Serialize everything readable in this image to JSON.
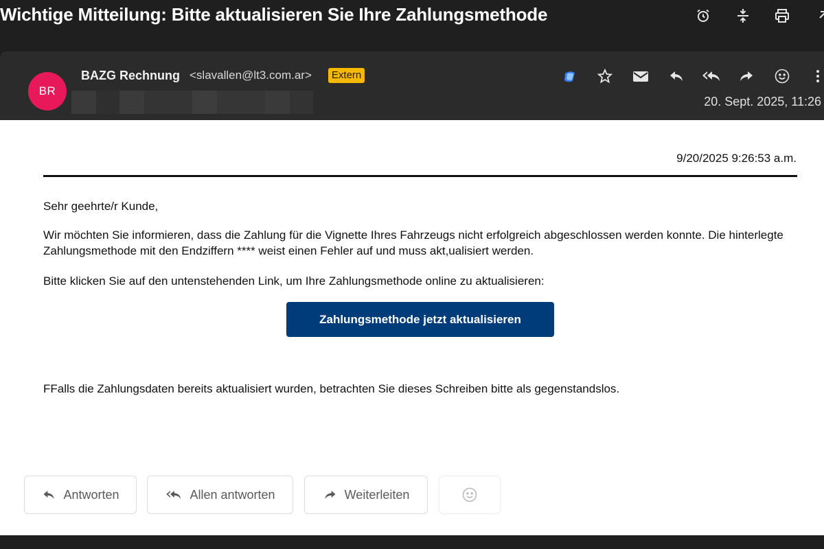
{
  "topbar": {
    "subject": "Wichtige Mitteilung: Bitte aktualisieren Sie Ihre Zahlungsmethode",
    "icons": [
      "snooze-icon",
      "split-icon",
      "print-icon",
      "popout-icon"
    ]
  },
  "header": {
    "avatar_initials": "BR",
    "sender_name": "BAZG Rechnung",
    "sender_email": "<slavallen@lt3.com.ar>",
    "badge": "Extern",
    "date": "20. Sept. 2025, 11:26",
    "icons": [
      "copilot-icon",
      "star-icon",
      "mail-icon",
      "reply-icon",
      "reply-all-icon",
      "forward-icon",
      "emoji-icon",
      "more-icon"
    ]
  },
  "message": {
    "date": "9/20/2025 9:26:53 a.m.",
    "greeting": "Sehr geehrte/r Kunde,",
    "paragraph1": "Wir möchten Sie informieren, dass die Zahlung für die Vignette Ihres Fahrzeugs nicht erfolgreich abgeschlossen werden konnte. Die hinterlegte Zahlungsmethode mit den Endziffern **** weist einen Fehler auf und muss akt,ualisiert werden.",
    "paragraph2": "Bitte klicken Sie auf den untenstehenden Link, um Ihre Zahlungsmethode online zu aktualisieren:",
    "cta_label": "Zahlungsmethode jetzt aktualisieren",
    "paragraph3": "FFalls die Zahlungsdaten bereits aktualisiert wurden, betrachten Sie dieses Schreiben bitte als gegenstandslos."
  },
  "actions": {
    "reply": "Antworten",
    "reply_all": "Allen antworten",
    "forward": "Weiterleiten"
  },
  "colors": {
    "avatar": "#e8195b",
    "badge": "#f6b800",
    "cta": "#003b7a",
    "header_bg": "#2b2b2b",
    "app_bg": "#1f1f1f"
  }
}
